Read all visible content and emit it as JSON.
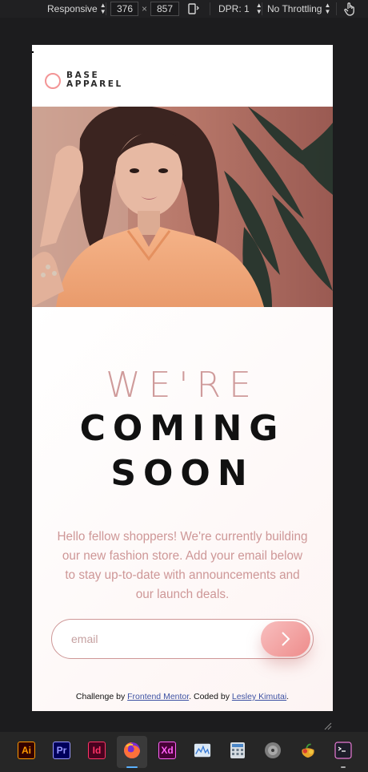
{
  "devtools": {
    "device_mode": "Responsive",
    "width": "376",
    "times": "×",
    "height": "857",
    "dpr": "DPR: 1",
    "throttling": "No Throttling"
  },
  "brand": {
    "line1": "BASE",
    "line2": "APPAREL",
    "accent_color": "#f39596"
  },
  "hero": {
    "headline_light": "WE'RE",
    "headline_bold_1": "COMING",
    "headline_bold_2": "SOON",
    "description": "Hello fellow shoppers! We're currently building our new fashion store. Add your email below to stay up-to-date with announcements and our launch deals."
  },
  "form": {
    "email_placeholder": "email",
    "submit_icon": "chevron-right-icon"
  },
  "footer": {
    "prefix": "Challenge by ",
    "link1": "Frontend Mentor",
    "middle": ". Coded by ",
    "link2": "Lesley Kimutai",
    "suffix": "."
  },
  "taskbar": {
    "apps": [
      {
        "name": "illustrator-icon",
        "label": "Ai"
      },
      {
        "name": "premiere-icon",
        "label": "Pr"
      },
      {
        "name": "indesign-icon",
        "label": "Id"
      },
      {
        "name": "firefox-icon",
        "label": ""
      },
      {
        "name": "xd-icon",
        "label": "Xd"
      },
      {
        "name": "system-monitor-icon",
        "label": ""
      },
      {
        "name": "calculator-icon",
        "label": ""
      },
      {
        "name": "disk-icon",
        "label": ""
      },
      {
        "name": "fruit-app-icon",
        "label": ""
      },
      {
        "name": "terminal-icon",
        "label": ""
      }
    ]
  }
}
